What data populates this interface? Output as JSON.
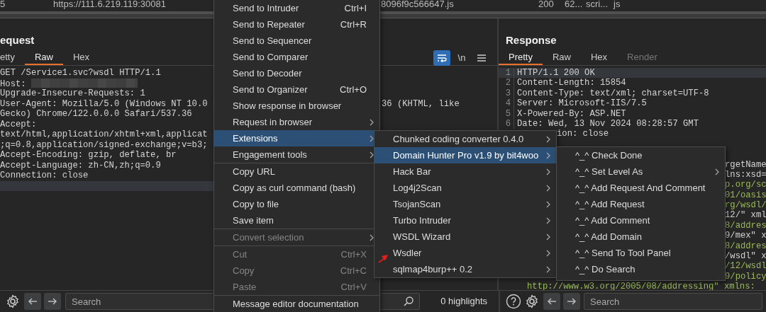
{
  "top_row": {
    "cells": [
      "5",
      "https://111.6.219.119:30081",
      "8096f9c566647.js",
      "200",
      "62...",
      "scri...",
      "js"
    ]
  },
  "request": {
    "title": "equest",
    "tabs": [
      {
        "label": "etty",
        "selected": false
      },
      {
        "label": "Raw",
        "selected": true
      },
      {
        "label": "Hex",
        "selected": false
      }
    ],
    "wrap_active": true,
    "newline_label": "\\n",
    "lines": [
      {
        "text": "GET /Service1.svc?wsdl HTTP/1.1",
        "current": false
      },
      {
        "text": "Host: ",
        "redacted": true,
        "current": false
      },
      {
        "text": "Upgrade-Insecure-Requests: 1",
        "current": false
      },
      {
        "text": "User-Agent: Mozilla/5.0 (Windows NT 10.0",
        "tail": "36 (KHTML, like",
        "current": false
      },
      {
        "text": "Gecko) Chrome/122.0.0.0 Safari/537.36",
        "current": false
      },
      {
        "text": "Accept:",
        "current": false
      },
      {
        "text": "text/html,application/xhtml+xml,applicat",
        "current": false
      },
      {
        "text": ";q=0.8,application/signed-exchange;v=b3;",
        "current": false
      },
      {
        "text": "Accept-Encoding: gzip, deflate, br",
        "current": false
      },
      {
        "text": "Accept-Language: zh-CN,zh;q=0.9",
        "current": false
      },
      {
        "text": "Connection: close",
        "current": false
      },
      {
        "current": true
      }
    ],
    "search": {
      "placeholder": "Search"
    },
    "highlights": "0 highlights"
  },
  "response": {
    "title": "Response",
    "tabs": [
      {
        "label": "Pretty",
        "selected": true,
        "disabled": false
      },
      {
        "label": "Raw",
        "selected": false,
        "disabled": false
      },
      {
        "label": "Hex",
        "selected": false,
        "disabled": false
      },
      {
        "label": "Render",
        "selected": false,
        "disabled": true
      }
    ],
    "lines": [
      {
        "number": "1",
        "text": "HTTP/1.1 200 OK",
        "current": true
      },
      {
        "number": "2",
        "text": "Content-Length: 15854",
        "current": false
      },
      {
        "number": "3",
        "text": "Content-Type: text/xml; charset=UTF-8",
        "current": false
      },
      {
        "number": "4",
        "text": "Server: Microsoft-IIS/7.5",
        "current": false
      },
      {
        "number": "5",
        "text": "X-Powered-By: ASP.NET",
        "current": false
      },
      {
        "number": "6",
        "text": "Date: Wed, 13 Nov 2024 08:28:57 GMT",
        "current": false
      },
      {
        "text": "ion: close",
        "current": false
      }
    ],
    "fragments": [
      {
        "text": "rgetName",
        "kind": "plain"
      },
      {
        "text": "lns:xsd=",
        "kind": "plain"
      },
      {
        "text": "p.org/sc",
        "kind": "string"
      },
      {
        "text": "01/oasis",
        "kind": "string"
      },
      {
        "text": "rg/wsdl/",
        "kind": "string"
      },
      {
        "text": "12/\" xml",
        "kind": "mixed"
      },
      {
        "text": "8/addres",
        "kind": "string"
      },
      {
        "text": "9/mex\" x",
        "kind": "mixed"
      },
      {
        "text": "8/addres",
        "kind": "string"
      },
      {
        "text": "/wsdl\" x",
        "kind": "mixed"
      },
      {
        "text": "/12/wsdl",
        "kind": "string"
      },
      {
        "text": "9/policy",
        "kind": "string"
      }
    ],
    "last_line": "http://www.w3.org/2005/08/addressing\" xmlns:",
    "search": {
      "placeholder": "Search"
    }
  },
  "context_menu": {
    "groups": [
      [
        {
          "label": "Send to Intruder",
          "shortcut": "Ctrl+I",
          "submenu": false,
          "disabled": false,
          "selected": false
        },
        {
          "label": "Send to Repeater",
          "shortcut": "Ctrl+R",
          "submenu": false,
          "disabled": false,
          "selected": false
        },
        {
          "label": "Send to Sequencer",
          "submenu": false,
          "disabled": false,
          "selected": false
        },
        {
          "label": "Send to Comparer",
          "submenu": false,
          "disabled": false,
          "selected": false
        },
        {
          "label": "Send to Decoder",
          "submenu": false,
          "disabled": false,
          "selected": false
        },
        {
          "label": "Send to Organizer",
          "shortcut": "Ctrl+O",
          "submenu": false,
          "disabled": false,
          "selected": false
        },
        {
          "label": "Show response in browser",
          "submenu": false,
          "disabled": false,
          "selected": false
        },
        {
          "label": "Request in browser",
          "submenu": true,
          "disabled": false,
          "selected": false
        },
        {
          "label": "Extensions",
          "submenu": true,
          "disabled": false,
          "selected": true
        },
        {
          "label": "Engagement tools",
          "submenu": true,
          "disabled": false,
          "selected": false
        }
      ],
      [
        {
          "label": "Copy URL",
          "submenu": false,
          "disabled": false,
          "selected": false
        },
        {
          "label": "Copy as curl command (bash)",
          "submenu": false,
          "disabled": false,
          "selected": false
        },
        {
          "label": "Copy to file",
          "submenu": false,
          "disabled": false,
          "selected": false
        },
        {
          "label": "Save item",
          "submenu": false,
          "disabled": false,
          "selected": false
        }
      ],
      [
        {
          "label": "Convert selection",
          "submenu": true,
          "disabled": true,
          "selected": false
        }
      ],
      [
        {
          "label": "Cut",
          "shortcut": "Ctrl+X",
          "submenu": false,
          "disabled": true,
          "selected": false
        },
        {
          "label": "Copy",
          "shortcut": "Ctrl+C",
          "submenu": false,
          "disabled": true,
          "selected": false
        },
        {
          "label": "Paste",
          "shortcut": "Ctrl+V",
          "submenu": false,
          "disabled": true,
          "selected": false
        }
      ],
      [
        {
          "label": "Message editor documentation",
          "submenu": false,
          "disabled": false,
          "selected": false
        }
      ]
    ]
  },
  "extensions_menu": {
    "items": [
      {
        "label": "Chunked coding converter 0.4.0",
        "submenu": true,
        "selected": false
      },
      {
        "label": "Domain Hunter Pro v1.9 by bit4woo",
        "submenu": true,
        "selected": true
      },
      {
        "label": "Hack Bar",
        "submenu": true,
        "selected": false
      },
      {
        "label": "Log4j2Scan",
        "submenu": true,
        "selected": false
      },
      {
        "label": "TsojanScan",
        "submenu": true,
        "selected": false
      },
      {
        "label": "Turbo Intruder",
        "submenu": true,
        "selected": false
      },
      {
        "label": "WSDL Wizard",
        "submenu": true,
        "selected": false
      },
      {
        "label": "Wsdler",
        "submenu": true,
        "selected": false,
        "pointer": true
      },
      {
        "label": "sqlmap4burp++ 0.2",
        "submenu": true,
        "selected": false
      }
    ]
  },
  "domain_hunter_menu": {
    "items": [
      {
        "label": "^_^ Check Done",
        "submenu": false,
        "selected": false
      },
      {
        "label": "^_^ Set Level As",
        "submenu": true,
        "selected": false
      },
      {
        "label": "^_^ Add Request And Comment",
        "submenu": false,
        "selected": false
      },
      {
        "label": "^_^ Add Request",
        "submenu": false,
        "selected": false
      },
      {
        "label": "^_^ Add Comment",
        "submenu": false,
        "selected": false
      },
      {
        "label": "^_^ Add Domain",
        "submenu": false,
        "selected": false
      },
      {
        "label": "^_^ Send To Tool Panel",
        "submenu": false,
        "selected": false
      },
      {
        "label": "^_^ Do Search",
        "submenu": false,
        "selected": false
      }
    ]
  }
}
